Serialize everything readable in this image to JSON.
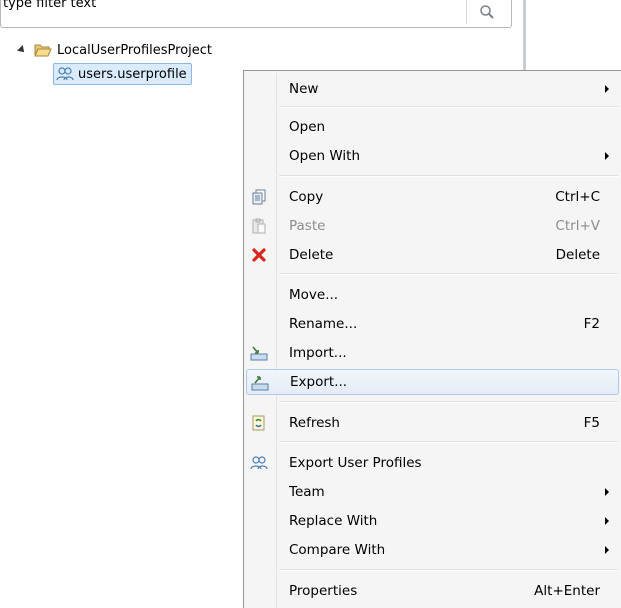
{
  "filter": {
    "value": "type filter text"
  },
  "tree": {
    "project": "LocalUserProfilesProject",
    "file": "users.userprofile"
  },
  "menu": {
    "items": [
      {
        "label": "New",
        "submenu": true
      },
      {
        "label": "Open"
      },
      {
        "label": "Open With",
        "submenu": true
      },
      {
        "label": "Copy",
        "shortcut": "Ctrl+C",
        "icon": "copy-icon"
      },
      {
        "label": "Paste",
        "shortcut": "Ctrl+V",
        "icon": "paste-icon",
        "disabled": true
      },
      {
        "label": "Delete",
        "shortcut": "Delete",
        "icon": "delete-icon"
      },
      {
        "label": "Move..."
      },
      {
        "label": "Rename...",
        "shortcut": "F2"
      },
      {
        "label": "Import...",
        "icon": "import-icon"
      },
      {
        "label": "Export...",
        "icon": "export-icon",
        "highlighted": true
      },
      {
        "label": "Refresh",
        "shortcut": "F5",
        "icon": "refresh-icon"
      },
      {
        "label": "Export User Profiles",
        "icon": "user-profiles-icon"
      },
      {
        "label": "Team",
        "submenu": true
      },
      {
        "label": "Replace With",
        "submenu": true
      },
      {
        "label": "Compare With",
        "submenu": true
      },
      {
        "label": "Properties",
        "shortcut": "Alt+Enter"
      }
    ]
  },
  "colors": {
    "menu_bg": "#f5f5f5",
    "highlight_border": "#aecae6",
    "selection_bg": "#d9ebfc",
    "delete_red": "#d9261c"
  }
}
